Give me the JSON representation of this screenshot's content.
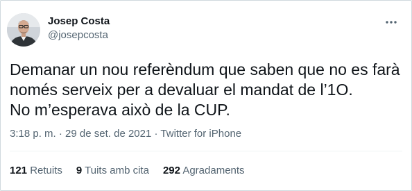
{
  "author": {
    "display_name": "Josep Costa",
    "handle": "@josepcosta"
  },
  "tweet": {
    "lines": [
      "Demanar un nou referèndum que saben que no es farà",
      "només serveix per a devaluar el mandat de l’1O.",
      "No m’esperava això de la CUP."
    ]
  },
  "meta": {
    "time": "3:18 p. m.",
    "separator": "·",
    "date": "29 de set. de 2021",
    "source": "Twitter for iPhone"
  },
  "stats": {
    "retweets_count": "121",
    "retweets_label": "Retuits",
    "quotes_count": "9",
    "quotes_label": "Tuits amb cita",
    "likes_count": "292",
    "likes_label": "Agradaments"
  },
  "colors": {
    "text_primary": "#0f1419",
    "text_secondary": "#536471",
    "border": "#cfd9de"
  },
  "icons": {
    "more": "more-horizontal-icon",
    "avatar": "profile-photo"
  }
}
